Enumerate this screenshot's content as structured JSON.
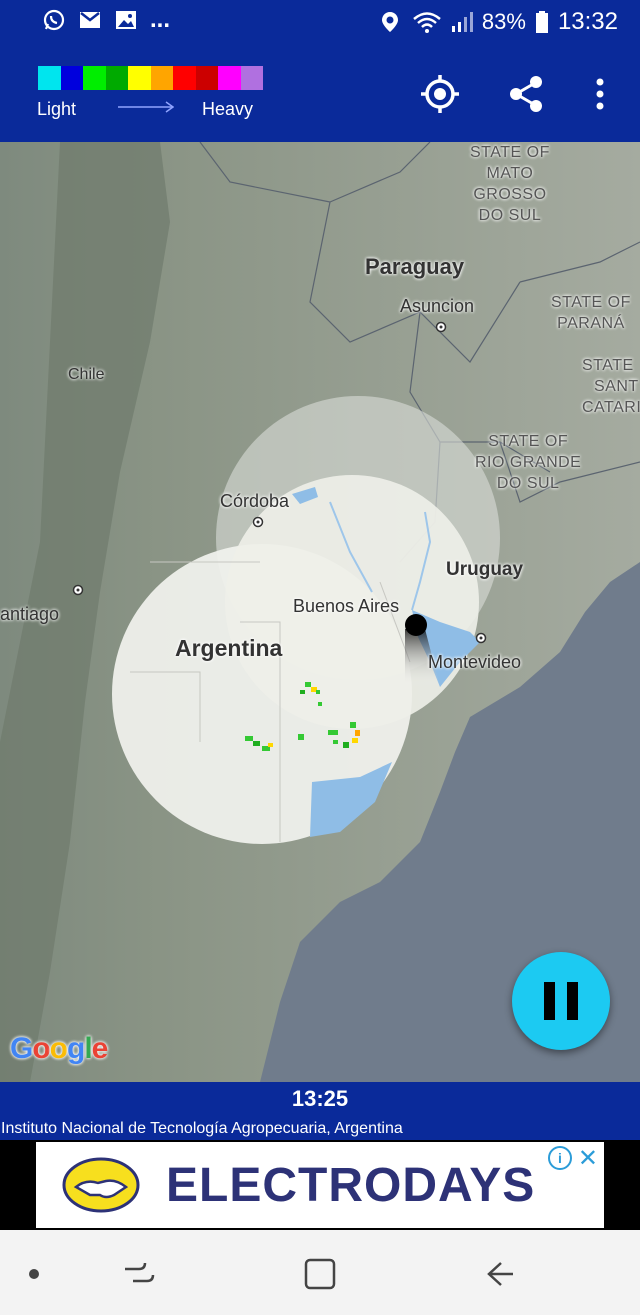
{
  "status_bar": {
    "notification_icons": [
      "whatsapp-icon",
      "gmail-icon",
      "gallery-icon"
    ],
    "more_indicator": "...",
    "battery": "83%",
    "time": "13:32"
  },
  "legend": {
    "colors": [
      "#00e5ee",
      "#0000dd",
      "#00ee00",
      "#00aa00",
      "#ffff00",
      "#ffa500",
      "#ff0000",
      "#cc0000",
      "#ff00ff",
      "#b070e0"
    ],
    "light_label": "Light",
    "heavy_label": "Heavy"
  },
  "toolbar": {
    "icons": [
      "my-location-icon",
      "share-icon",
      "more-vert-icon"
    ]
  },
  "map": {
    "labels": {
      "state_mato_grosso": [
        "STATE OF",
        "MATO",
        "GROSSO",
        "DO SUL"
      ],
      "paraguay": "Paraguay",
      "asuncion": "Asuncion",
      "state_parana": [
        "STATE OF",
        "PARANÁ"
      ],
      "state_santa_catarina": [
        "STATE",
        "SANT",
        "CATARI"
      ],
      "chile": "Chile",
      "state_rio_grande": [
        "STATE OF",
        "RIO GRANDE",
        "DO SUL"
      ],
      "cordoba": "Córdoba",
      "uruguay": "Uruguay",
      "santiago": "antiago",
      "buenos_aires": "Buenos Aires",
      "argentina": "Argentina",
      "montevideo": "Montevideo"
    },
    "logo_text": "Google"
  },
  "playback": {
    "time": "13:25",
    "source": "Instituto Nacional de Tecnología Agropecuaria, Argentina"
  },
  "ad": {
    "text": "ELECTRODAYS",
    "info_symbol": "i",
    "close_symbol": "✕"
  },
  "nav": {
    "buttons": [
      "dot-icon",
      "recent-apps-icon",
      "home-icon",
      "back-icon"
    ]
  }
}
